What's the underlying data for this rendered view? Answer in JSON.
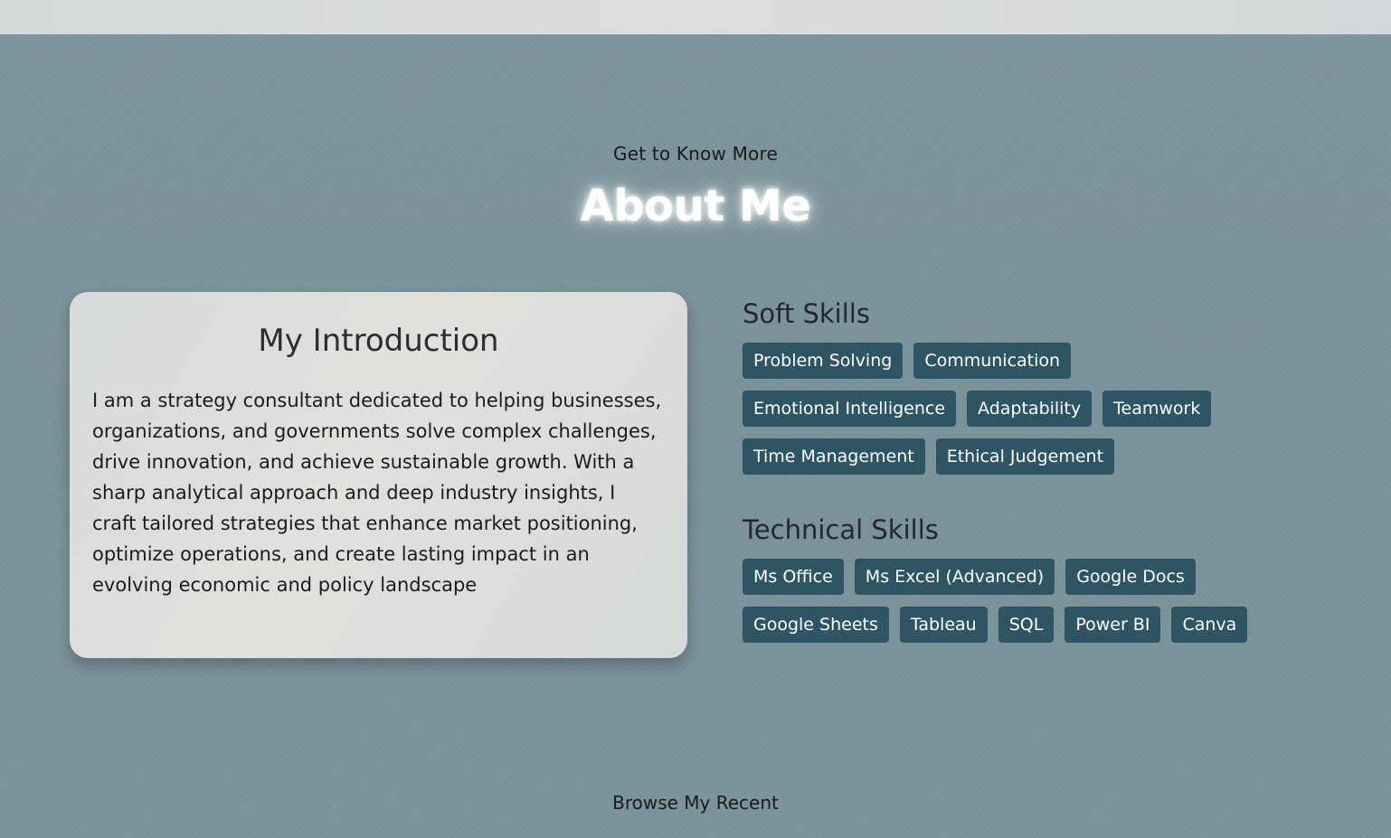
{
  "about": {
    "eyebrow": "Get to Know More",
    "title": "About Me",
    "intro": {
      "title": "My Introduction",
      "text": "I am a strategy consultant dedicated to helping businesses, organizations, and governments solve complex challenges, drive innovation, and achieve sustainable growth. With a sharp analytical approach and deep industry insights, I craft tailored strategies that enhance market positioning, optimize operations, and create lasting impact in an evolving economic and policy landscape"
    },
    "soft_skills": {
      "title": "Soft Skills",
      "items": [
        "Problem Solving",
        "Communication",
        "Emotional Intelligence",
        "Adaptability",
        "Teamwork",
        "Time Management",
        "Ethical Judgement"
      ]
    },
    "technical_skills": {
      "title": "Technical Skills",
      "items": [
        "Ms Office",
        "Ms Excel (Advanced)",
        "Google Docs",
        "Google Sheets",
        "Tableau",
        "SQL",
        "Power BI",
        "Canva"
      ]
    }
  },
  "next_section": {
    "eyebrow": "Browse My Recent"
  },
  "colors": {
    "background": "#7b939b",
    "tag_background": "#2d5563",
    "card_background": "#dcdedc"
  }
}
